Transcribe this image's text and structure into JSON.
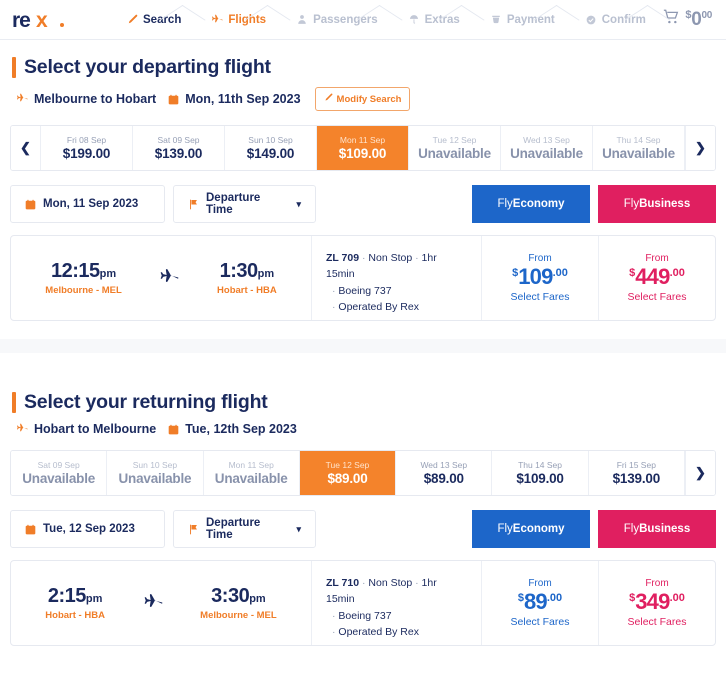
{
  "header": {
    "logo_text": "rex.",
    "steps": [
      {
        "label": "Search",
        "icon": "pencil-icon",
        "state": "active-dark"
      },
      {
        "label": "Flights",
        "icon": "plane-icon",
        "state": "active-orange"
      },
      {
        "label": "Passengers",
        "icon": "person-icon",
        "state": "inactive"
      },
      {
        "label": "Extras",
        "icon": "umbrella-icon",
        "state": "inactive"
      },
      {
        "label": "Payment",
        "icon": "card-icon",
        "state": "inactive"
      },
      {
        "label": "Confirm",
        "icon": "check-icon",
        "state": "inactive"
      }
    ],
    "cart": {
      "icon": "cart-icon",
      "currency": "$",
      "amount": "0",
      "cents": "00"
    }
  },
  "colors": {
    "navy": "#1b2a5e",
    "orange": "#f07d28",
    "selected_orange": "#f4832b",
    "economy_blue": "#1d66c9",
    "business_pink": "#e01f60",
    "muted": "#97a0b6"
  },
  "departing": {
    "title": "Select your departing flight",
    "route": "Melbourne to Hobart",
    "date": "Mon, 11th Sep 2023",
    "modify_label": "Modify Search",
    "route_icon": "plane-icon",
    "date_icon": "calendar-icon",
    "modify_icon": "pencil-icon",
    "has_left_arrow": true,
    "has_right_arrow": true,
    "dates": [
      {
        "day": "Fri 08 Sep",
        "price": "$199.00",
        "state": "available"
      },
      {
        "day": "Sat 09 Sep",
        "price": "$139.00",
        "state": "available"
      },
      {
        "day": "Sun 10 Sep",
        "price": "$149.00",
        "state": "available"
      },
      {
        "day": "Mon 11 Sep",
        "price": "$109.00",
        "state": "selected"
      },
      {
        "day": "Tue 12 Sep",
        "price": "Unavailable",
        "state": "unavailable"
      },
      {
        "day": "Wed 13 Sep",
        "price": "Unavailable",
        "state": "unavailable"
      },
      {
        "day": "Thu 14 Sep",
        "price": "Unavailable",
        "state": "unavailable"
      }
    ],
    "filter_date": "Mon, 11 Sep 2023",
    "filter_sort": "Departure Time",
    "fly_economy": "Fly ",
    "fly_economy_b": "Economy",
    "fly_business": "Fly ",
    "fly_business_b": "Business",
    "flight": {
      "depart_time": "12:15",
      "depart_ampm": "pm",
      "depart_port": "Melbourne - MEL",
      "arrive_time": "1:30",
      "arrive_ampm": "pm",
      "arrive_port": "Hobart - HBA",
      "number": "ZL 709",
      "stops": "Non Stop",
      "duration": "1hr 15min",
      "aircraft": "Boeing 737",
      "operator": "Operated By Rex",
      "economy": {
        "from": "From",
        "currency": "$",
        "amount": "109",
        "cents": ".00",
        "action": "Select Fares"
      },
      "business": {
        "from": "From",
        "currency": "$",
        "amount": "449",
        "cents": ".00",
        "action": "Select Fares"
      }
    }
  },
  "returning": {
    "title": "Select your returning flight",
    "route": "Hobart to Melbourne",
    "date": "Tue, 12th Sep 2023",
    "route_icon": "plane-icon",
    "date_icon": "calendar-icon",
    "has_left_arrow": false,
    "has_right_arrow": true,
    "dates": [
      {
        "day": "Sat 09 Sep",
        "price": "Unavailable",
        "state": "unavailable"
      },
      {
        "day": "Sun 10 Sep",
        "price": "Unavailable",
        "state": "unavailable"
      },
      {
        "day": "Mon 11 Sep",
        "price": "Unavailable",
        "state": "unavailable"
      },
      {
        "day": "Tue 12 Sep",
        "price": "$89.00",
        "state": "selected"
      },
      {
        "day": "Wed 13 Sep",
        "price": "$89.00",
        "state": "available"
      },
      {
        "day": "Thu 14 Sep",
        "price": "$109.00",
        "state": "available"
      },
      {
        "day": "Fri 15 Sep",
        "price": "$139.00",
        "state": "available"
      }
    ],
    "filter_date": "Tue, 12 Sep 2023",
    "filter_sort": "Departure Time",
    "fly_economy": "Fly ",
    "fly_economy_b": "Economy",
    "fly_business": "Fly ",
    "fly_business_b": "Business",
    "flight": {
      "depart_time": "2:15",
      "depart_ampm": "pm",
      "depart_port": "Hobart - HBA",
      "arrive_time": "3:30",
      "arrive_ampm": "pm",
      "arrive_port": "Melbourne - MEL",
      "number": "ZL 710",
      "stops": "Non Stop",
      "duration": "1hr 15min",
      "aircraft": "Boeing 737",
      "operator": "Operated By Rex",
      "economy": {
        "from": "From",
        "currency": "$",
        "amount": "89",
        "cents": ".00",
        "action": "Select Fares"
      },
      "business": {
        "from": "From",
        "currency": "$",
        "amount": "349",
        "cents": ".00",
        "action": "Select Fares"
      }
    }
  }
}
